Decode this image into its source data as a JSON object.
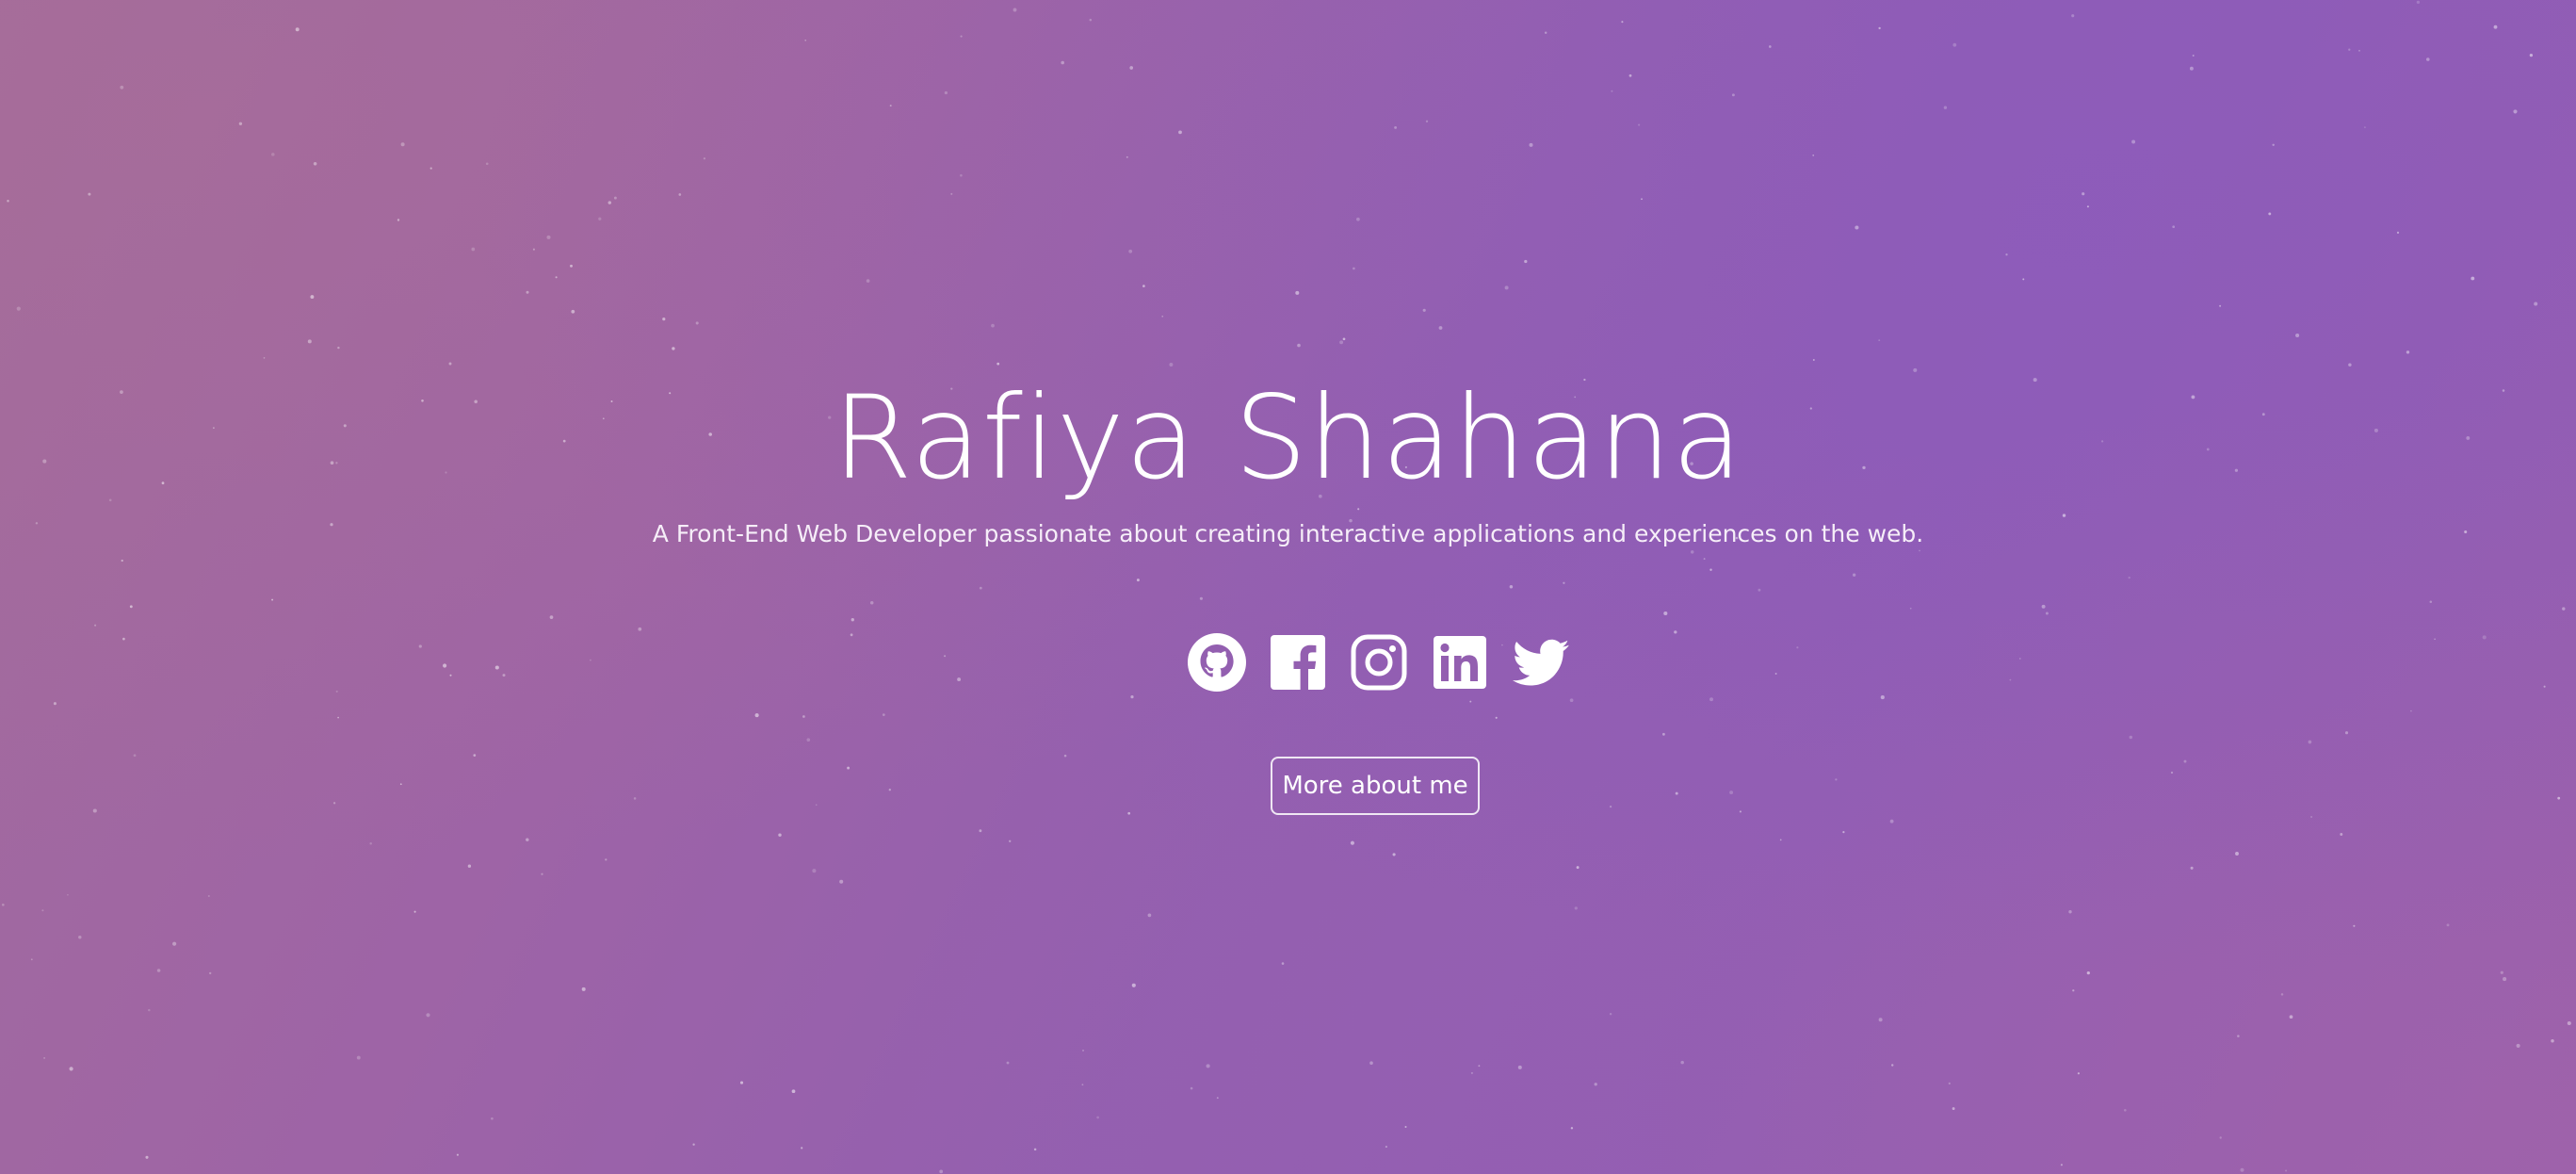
{
  "hero": {
    "name": "Rafiya Shahana",
    "tagline": "A Front-End Web Developer passionate about creating interactive applications and experiences on the web.",
    "more_button_label": "More about me"
  },
  "social_links": [
    {
      "icon": "github-icon",
      "label": "GitHub"
    },
    {
      "icon": "facebook-icon",
      "label": "Facebook"
    },
    {
      "icon": "instagram-icon",
      "label": "Instagram"
    },
    {
      "icon": "linkedin-icon",
      "label": "LinkedIn"
    },
    {
      "icon": "twitter-icon",
      "label": "Twitter"
    }
  ],
  "colors": {
    "background_start": "#a36c9c",
    "background_mid": "#935fb0",
    "background_end": "#9960ab",
    "text": "#ffffff"
  }
}
